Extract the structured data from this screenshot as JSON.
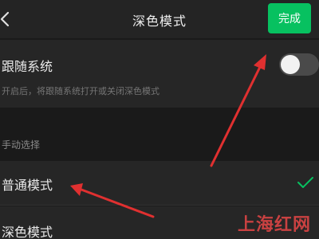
{
  "header": {
    "title": "深色模式",
    "done_label": "完成"
  },
  "follow_system": {
    "label": "跟随系统",
    "description": "开启后，将跟随系统打开或关闭深色模式",
    "enabled": false
  },
  "manual": {
    "section_label": "手动选择",
    "options": [
      {
        "label": "普通模式",
        "selected": true
      },
      {
        "label": "深色模式",
        "selected": false
      }
    ]
  },
  "watermark": "上海红网",
  "colors": {
    "accent": "#07c160",
    "background": "#1a1a1a",
    "annotation": "#e03030"
  },
  "icons": {
    "back": "chevron-left-icon",
    "check": "check-icon"
  }
}
